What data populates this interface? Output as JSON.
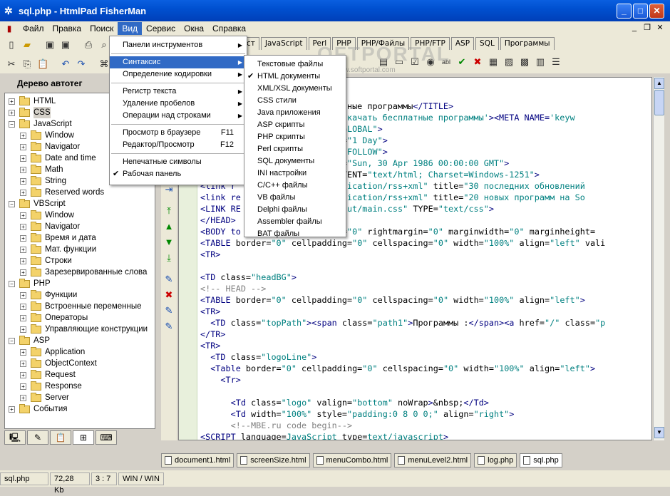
{
  "window": {
    "title": "sql.php - HtmlPad FisherMan"
  },
  "menubar": [
    "Файл",
    "Правка",
    "Поиск",
    "Вид",
    "Сервис",
    "Окна",
    "Справка"
  ],
  "toolbar_tabs": [
    "ст",
    "JavaScript",
    "Perl",
    "PHP",
    "PHP/Файлы",
    "PHP/FTP",
    "ASP",
    "SQL",
    "Программы"
  ],
  "left_panel": {
    "header": "Дерево автотег",
    "tree": [
      {
        "label": "HTML",
        "level": 0,
        "exp": "+"
      },
      {
        "label": "CSS",
        "level": 0,
        "exp": "+"
      },
      {
        "label": "JavaScript",
        "level": 0,
        "exp": "−"
      },
      {
        "label": "Window",
        "level": 1,
        "exp": "+"
      },
      {
        "label": "Navigator",
        "level": 1,
        "exp": "+"
      },
      {
        "label": "Date and time",
        "level": 1,
        "exp": "+"
      },
      {
        "label": "Math",
        "level": 1,
        "exp": "+"
      },
      {
        "label": "String",
        "level": 1,
        "exp": "+"
      },
      {
        "label": "Reserved words",
        "level": 1,
        "exp": "+"
      },
      {
        "label": "VBScript",
        "level": 0,
        "exp": "−"
      },
      {
        "label": "Window",
        "level": 1,
        "exp": "+"
      },
      {
        "label": "Navigator",
        "level": 1,
        "exp": "+"
      },
      {
        "label": "Время и дата",
        "level": 1,
        "exp": "+"
      },
      {
        "label": "Мат. функции",
        "level": 1,
        "exp": "+"
      },
      {
        "label": "Строки",
        "level": 1,
        "exp": "+"
      },
      {
        "label": "Зарезервированные слова",
        "level": 1,
        "exp": "+"
      },
      {
        "label": "PHP",
        "level": 0,
        "exp": "−"
      },
      {
        "label": "Функции",
        "level": 1,
        "exp": "+"
      },
      {
        "label": "Встроенные переменные",
        "level": 1,
        "exp": "+"
      },
      {
        "label": "Операторы",
        "level": 1,
        "exp": "+"
      },
      {
        "label": "Управляющие конструкции",
        "level": 1,
        "exp": "+"
      },
      {
        "label": "ASP",
        "level": 0,
        "exp": "−"
      },
      {
        "label": "Application",
        "level": 1,
        "exp": "+"
      },
      {
        "label": "ObjectContext",
        "level": 1,
        "exp": "+"
      },
      {
        "label": "Request",
        "level": 1,
        "exp": "+"
      },
      {
        "label": "Response",
        "level": 1,
        "exp": "+"
      },
      {
        "label": "Server",
        "level": 1,
        "exp": "+"
      },
      {
        "label": "События",
        "level": 0,
        "exp": "+"
      }
    ]
  },
  "view_menu": {
    "items": [
      {
        "label": "Панели инструментов",
        "sub": true
      },
      {
        "sep": true
      },
      {
        "label": "Синтаксис",
        "sub": true,
        "selected": true
      },
      {
        "label": "Определение кодировки",
        "sub": true
      },
      {
        "sep": true
      },
      {
        "label": "Регистр текста",
        "sub": true
      },
      {
        "label": "Удаление пробелов",
        "sub": true
      },
      {
        "label": "Операции над строками",
        "sub": true
      },
      {
        "sep": true
      },
      {
        "label": "Просмотр в браузере",
        "shortcut": "F11"
      },
      {
        "label": "Редактор/Просмотр",
        "shortcut": "F12"
      },
      {
        "sep": true
      },
      {
        "label": "Непечатные символы"
      },
      {
        "label": "Рабочая панель",
        "checked": true
      }
    ]
  },
  "syntax_menu": {
    "items": [
      {
        "label": "Текстовые файлы"
      },
      {
        "label": "HTML документы",
        "checked": true
      },
      {
        "label": "XML/XSL документы"
      },
      {
        "label": "CSS стили"
      },
      {
        "label": "Java приложения"
      },
      {
        "label": "ASP скрипты"
      },
      {
        "label": "PHP скрипты"
      },
      {
        "label": "Perl скрипты"
      },
      {
        "label": "SQL документы"
      },
      {
        "label": "INI настройки"
      },
      {
        "label": "C/C++ файлы"
      },
      {
        "label": "VB файлы"
      },
      {
        "label": "Delphi файлы"
      },
      {
        "label": "Assembler файлы"
      },
      {
        "label": "BAT файлы"
      }
    ]
  },
  "code_lines": [
    [],
    [],
    [
      [
        "txt",
        "                      бесплатные программы"
      ],
      [
        "tag",
        "</TITLE>"
      ]
    ],
    [
      [
        "attr",
        "                   CONTENT="
      ],
      [
        "val",
        "'Скачать бесплатные программы'"
      ],
      [
        "tag",
        "><META NAME="
      ],
      [
        "val",
        "'keyw"
      ]
    ],
    [
      [
        "attr",
        "                   CONTENT="
      ],
      [
        "val",
        "\"GLOBAL\""
      ],
      [
        "tag",
        ">"
      ]
    ],
    [
      [
        "attr",
        "                   \" CONTENT="
      ],
      [
        "val",
        "\"1 Day\""
      ],
      [
        "tag",
        ">"
      ]
    ],
    [
      [
        "attr",
        "                   nt="
      ],
      [
        "val",
        "\"INDEX,FOLLOW\""
      ],
      [
        "tag",
        ">"
      ]
    ],
    [
      [
        "attr",
        "                   \" CONTENT="
      ],
      [
        "val",
        "\"Sun, 30 Apr 1986 00:00:00 GMT\""
      ],
      [
        "tag",
        ">"
      ]
    ],
    [
      [
        "attr",
        "                   Type\" CONTENT="
      ],
      [
        "val",
        "\"text/html; Charset=Windows-1251\""
      ],
      [
        "tag",
        ">"
      ]
    ],
    [
      [
        "tag",
        "<link r"
      ],
      [
        "attr",
        "                ="
      ],
      [
        "val",
        "\"application/rss+xml\""
      ],
      [
        "attr",
        " title="
      ],
      [
        "val",
        "\"30 последних обновлений"
      ]
    ],
    [
      [
        "tag",
        "<link re"
      ],
      [
        "attr",
        "               ="
      ],
      [
        "val",
        "\"application/rss+xml\""
      ],
      [
        "attr",
        " title="
      ],
      [
        "val",
        "\"20 новых программ на So"
      ]
    ],
    [
      [
        "tag",
        "<LINK RE"
      ],
      [
        "attr",
        "               F="
      ],
      [
        "val",
        "\"/_cut/main.css\""
      ],
      [
        "attr",
        " TYPE="
      ],
      [
        "val",
        "\"text/css\""
      ],
      [
        "tag",
        ">"
      ]
    ],
    [
      [
        "tag",
        "</HEAD>"
      ]
    ],
    [
      [
        "tag",
        "<BODY to"
      ],
      [
        "attr",
        "               argin="
      ],
      [
        "val",
        "\"0\""
      ],
      [
        "attr",
        " rightmargin="
      ],
      [
        "val",
        "\"0\""
      ],
      [
        "attr",
        " marginwidth="
      ],
      [
        "val",
        "\"0\""
      ],
      [
        "attr",
        " marginheight="
      ]
    ],
    [
      [
        "tag",
        "<TABLE "
      ],
      [
        "attr",
        "border="
      ],
      [
        "val",
        "\"0\""
      ],
      [
        "attr",
        " cellpadding="
      ],
      [
        "val",
        "\"0\""
      ],
      [
        "attr",
        " cellspacing="
      ],
      [
        "val",
        "\"0\""
      ],
      [
        "attr",
        " width="
      ],
      [
        "val",
        "\"100%\""
      ],
      [
        "attr",
        " align="
      ],
      [
        "val",
        "\"left\""
      ],
      [
        "attr",
        " vali"
      ]
    ],
    [
      [
        "tag",
        "<TR>"
      ]
    ],
    [],
    [
      [
        "tag",
        "<TD "
      ],
      [
        "attr",
        "class="
      ],
      [
        "val",
        "\"headBG\""
      ],
      [
        "tag",
        ">"
      ]
    ],
    [
      [
        "com",
        "<!-- HEAD -->"
      ]
    ],
    [
      [
        "tag",
        "<TABLE "
      ],
      [
        "attr",
        "border="
      ],
      [
        "val",
        "\"0\""
      ],
      [
        "attr",
        " cellpadding="
      ],
      [
        "val",
        "\"0\""
      ],
      [
        "attr",
        " cellspacing="
      ],
      [
        "val",
        "\"0\""
      ],
      [
        "attr",
        " width="
      ],
      [
        "val",
        "\"100%\""
      ],
      [
        "attr",
        " align="
      ],
      [
        "val",
        "\"left\""
      ],
      [
        "tag",
        ">"
      ]
    ],
    [
      [
        "tag",
        "<TR>"
      ]
    ],
    [
      [
        "tag",
        "  <TD "
      ],
      [
        "attr",
        "class="
      ],
      [
        "val",
        "\"topPath\""
      ],
      [
        "tag",
        "><span "
      ],
      [
        "attr",
        "class="
      ],
      [
        "val",
        "\"path1\""
      ],
      [
        "tag",
        ">"
      ],
      [
        "txt",
        "Программы :"
      ],
      [
        "tag",
        "</span><a "
      ],
      [
        "attr",
        "href="
      ],
      [
        "val",
        "\"/\""
      ],
      [
        "attr",
        " class="
      ],
      [
        "val",
        "\"p"
      ]
    ],
    [
      [
        "tag",
        "</TR>"
      ]
    ],
    [
      [
        "tag",
        "<TR>"
      ]
    ],
    [
      [
        "tag",
        "  <TD "
      ],
      [
        "attr",
        "class="
      ],
      [
        "val",
        "\"logoLine\""
      ],
      [
        "tag",
        ">"
      ]
    ],
    [
      [
        "tag",
        "  <Table "
      ],
      [
        "attr",
        "border="
      ],
      [
        "val",
        "\"0\""
      ],
      [
        "attr",
        " cellpadding="
      ],
      [
        "val",
        "\"0\""
      ],
      [
        "attr",
        " cellspacing="
      ],
      [
        "val",
        "\"0\""
      ],
      [
        "attr",
        " width="
      ],
      [
        "val",
        "\"100%\""
      ],
      [
        "attr",
        " align="
      ],
      [
        "val",
        "\"left\""
      ],
      [
        "tag",
        ">"
      ]
    ],
    [
      [
        "tag",
        "    <Tr>"
      ]
    ],
    [],
    [
      [
        "tag",
        "      <Td "
      ],
      [
        "attr",
        "class="
      ],
      [
        "val",
        "\"logo\""
      ],
      [
        "attr",
        " valign="
      ],
      [
        "val",
        "\"bottom\""
      ],
      [
        "attr",
        " noWrap"
      ],
      [
        "tag",
        ">"
      ],
      [
        "txt",
        "&nbsp;"
      ],
      [
        "tag",
        "</Td>"
      ]
    ],
    [
      [
        "tag",
        "      <Td "
      ],
      [
        "attr",
        "width="
      ],
      [
        "val",
        "\"100%\""
      ],
      [
        "attr",
        " style="
      ],
      [
        "val",
        "\"padding:0 8 0 0;\""
      ],
      [
        "attr",
        " align="
      ],
      [
        "val",
        "\"right\""
      ],
      [
        "tag",
        ">"
      ]
    ],
    [
      [
        "com",
        "      <!--MBE.ru code begin-->"
      ]
    ],
    [
      [
        "tag",
        "<SCRIPT "
      ],
      [
        "attr",
        "language="
      ],
      [
        "val",
        "JavaScript"
      ],
      [
        "attr",
        " type="
      ],
      [
        "val",
        "text/javascript"
      ],
      [
        "tag",
        ">"
      ]
    ]
  ],
  "doc_tabs": [
    "document1.html",
    "screenSize.html",
    "menuCombo.html",
    "menuLevel2.html",
    "log.php",
    "sql.php"
  ],
  "status": {
    "file": "sql.php",
    "size": "72,28 Kb",
    "pos": "3 : 7",
    "encoding": "WIN / WIN"
  },
  "watermark": {
    "logo": "OFTPORTAL",
    "site": "www.softportal.com"
  }
}
